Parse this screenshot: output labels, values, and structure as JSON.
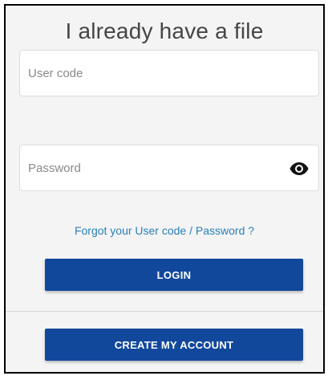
{
  "login_panel": {
    "title": "I already have a file",
    "user_code": {
      "value": "",
      "placeholder": "User code"
    },
    "password": {
      "value": "",
      "placeholder": "Password",
      "toggle_icon": "eye-icon"
    },
    "forgot_link": "Forgot your User code / Password ?",
    "login_label": "LOGIN",
    "create_account_label": "CREATE MY ACCOUNT"
  },
  "colors": {
    "primary_button": "#12489c",
    "link": "#2a7fb8",
    "panel_background": "#f4f4f4"
  }
}
